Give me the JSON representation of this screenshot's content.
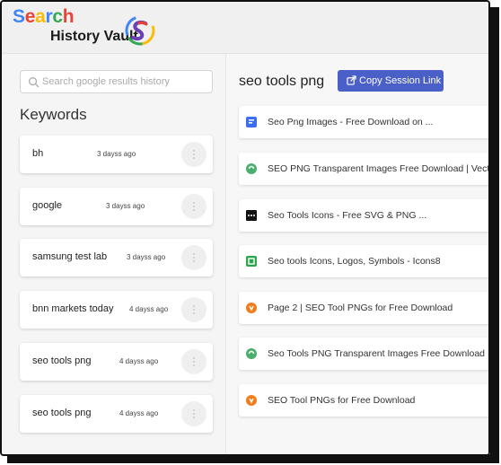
{
  "app": {
    "logo_word_1": "Search",
    "logo_word_2": "History Vault",
    "logo_letter_colors": [
      "#4285F4",
      "#EA4335",
      "#FBBC05",
      "#4285F4",
      "#34A853",
      "#EA4335"
    ]
  },
  "sidebar": {
    "search": {
      "placeholder": "Search google results history",
      "value": ""
    },
    "heading": "Keywords",
    "keywords": [
      {
        "text": "bh",
        "time": "3 dayss ago"
      },
      {
        "text": "google",
        "time": "3 dayss ago"
      },
      {
        "text": "samsung test lab",
        "time": "3 dayss ago"
      },
      {
        "text": "bnn markets today",
        "time": "4 dayss ago"
      },
      {
        "text": "seo tools png",
        "time": "4 dayss ago"
      },
      {
        "text": "seo tools png",
        "time": "4 dayss ago"
      }
    ]
  },
  "main": {
    "session_title": "seo tools png",
    "copy_button_label": "Copy Session Link",
    "accent_color": "#4B5FC9",
    "results": [
      {
        "text": "Seo Png Images - Free Download on ...",
        "icon": "blue-square-favicon"
      },
      {
        "text": "SEO PNG Transparent Images Free Download | Vector F",
        "icon": "green-circle-favicon"
      },
      {
        "text": "Seo Tools Icons - Free SVG & PNG ...",
        "icon": "black-dots-favicon"
      },
      {
        "text": "Seo tools Icons, Logos, Symbols - Icons8",
        "icon": "green-square-favicon"
      },
      {
        "text": "Page 2 | SEO Tool PNGs for Free Download",
        "icon": "orange-circle-favicon"
      },
      {
        "text": "Seo Tools PNG Transparent Images Free Download",
        "icon": "green-circle-favicon"
      },
      {
        "text": "SEO Tool PNGs for Free Download",
        "icon": "orange-circle-favicon"
      }
    ]
  }
}
